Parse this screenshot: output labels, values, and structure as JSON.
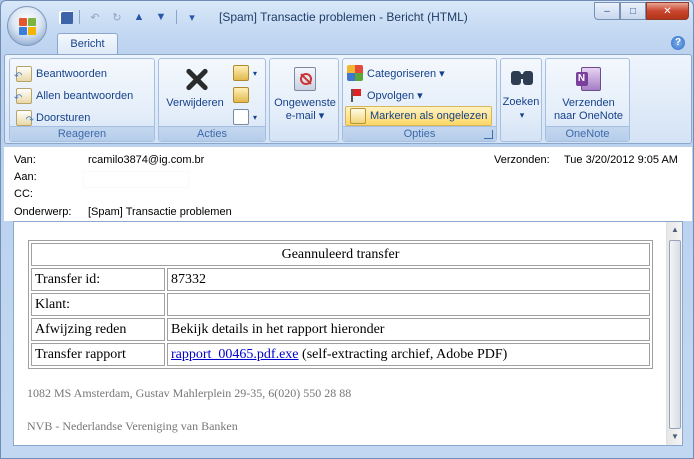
{
  "window": {
    "title": "[Spam] Transactie problemen - Bericht (HTML)",
    "controls": {
      "minimize": "–",
      "maximize": "□",
      "close": "✕"
    }
  },
  "quick_access": {
    "save": "💾",
    "undo": "↶",
    "redo": "↻",
    "up": "▲",
    "down": "▼",
    "more": "▾"
  },
  "tabs": [
    {
      "label": "Bericht",
      "selected": true
    }
  ],
  "help": "?",
  "ribbon": {
    "groups": {
      "reageren": {
        "label": "Reageren",
        "buttons": [
          "Beantwoorden",
          "Allen beantwoorden",
          "Doorsturen"
        ]
      },
      "acties": {
        "label": "Acties",
        "delete": "Verwijderen"
      },
      "junk": {
        "label_line1": "Ongewenste",
        "label_line2": "e-mail ▾"
      },
      "opties": {
        "label": "Opties",
        "categorize": "Categoriseren ▾",
        "follow_up": "Opvolgen ▾",
        "mark_unread": "Markeren als ongelezen"
      },
      "zoeken": {
        "label": "Zoeken",
        "arrow": "▾"
      },
      "onenote": {
        "label": "OneNote",
        "send_line1": "Verzenden",
        "send_line2": "naar OneNote"
      }
    }
  },
  "headers": {
    "from_label": "Van:",
    "from_value": "rcamilo3874@ig.com.br",
    "to_label": "Aan:",
    "to_value": "",
    "cc_label": "CC:",
    "subject_label": "Onderwerp:",
    "subject_value": "[Spam] Transactie problemen",
    "sent_label": "Verzonden:",
    "sent_value": "Tue 3/20/2012 9:05 AM"
  },
  "message": {
    "table_title": "Geannuleerd transfer",
    "rows": [
      {
        "label": "Transfer id:",
        "value": "87332"
      },
      {
        "label": "Klant:",
        "value": ""
      },
      {
        "label": "Afwijzing reden",
        "value": "Bekijk details in het rapport hieronder"
      }
    ],
    "report_label": "Transfer rapport",
    "report_link": "rapport_00465.pdf.exe",
    "report_suffix": " (self-extracting archief, Adobe PDF)",
    "address_line": "1082 MS Amsterdam, Gustav Mahlerplein 29-35, 6(020) 550 28 88",
    "org_line": "NVB - Nederlandse Vereniging van Banken"
  },
  "colors": {
    "ribbon_text": "#15428b",
    "link": "#0000cc",
    "close_button": "#c9452f"
  }
}
